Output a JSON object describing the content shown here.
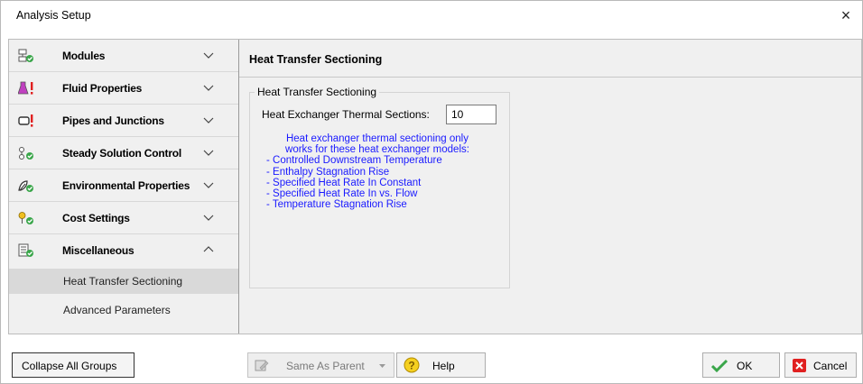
{
  "window": {
    "title": "Analysis Setup",
    "close_glyph": "×"
  },
  "sidebar": {
    "groups": [
      {
        "label": "Modules",
        "icon": "modules-icon",
        "expanded": false
      },
      {
        "label": "Fluid Properties",
        "icon": "flask-warning-icon",
        "expanded": false
      },
      {
        "label": "Pipes and Junctions",
        "icon": "pipe-warning-icon",
        "expanded": false
      },
      {
        "label": "Steady Solution Control",
        "icon": "solution-control-icon",
        "expanded": false
      },
      {
        "label": "Environmental Properties",
        "icon": "environment-icon",
        "expanded": false
      },
      {
        "label": "Cost Settings",
        "icon": "cost-icon",
        "expanded": false
      },
      {
        "label": "Miscellaneous",
        "icon": "miscellaneous-icon",
        "expanded": true
      }
    ],
    "subitems": [
      {
        "label": "Heat Transfer Sectioning",
        "selected": true
      },
      {
        "label": "Advanced Parameters",
        "selected": false
      }
    ]
  },
  "content": {
    "header": "Heat Transfer Sectioning",
    "groupbox_title": "Heat Transfer Sectioning",
    "field_label": "Heat Exchanger Thermal Sections:",
    "field_value": "10",
    "info_lines": [
      "Heat exchanger thermal sectioning only",
      "works for these heat exchanger models:",
      " - Controlled Downstream Temperature",
      " - Enthalpy Stagnation Rise",
      " - Specified Heat Rate In Constant",
      " - Specified Heat Rate In vs. Flow",
      " - Temperature Stagnation Rise"
    ]
  },
  "footer": {
    "collapse_label": "Collapse All Groups",
    "same_as_parent_label": "Same As Parent",
    "help_label": "Help",
    "ok_label": "OK",
    "cancel_label": "Cancel"
  },
  "colors": {
    "accent_green": "#3aa64a",
    "warning_red": "#e02020",
    "info_blue": "#1a1aff"
  }
}
